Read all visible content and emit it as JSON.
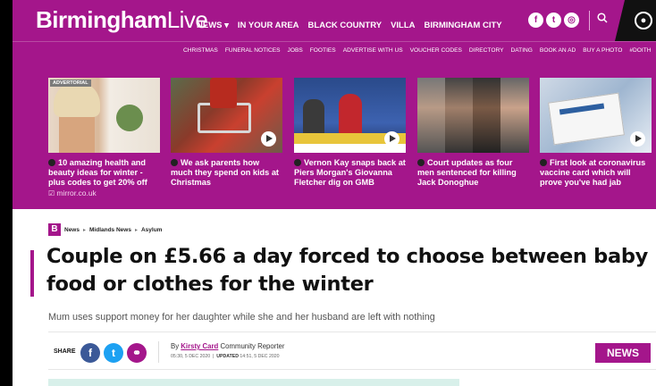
{
  "header": {
    "logo_bold": "Birmingham",
    "logo_light": "Live",
    "nav": [
      "NEWS ▾",
      "IN YOUR AREA",
      "BLACK COUNTRY",
      "VILLA",
      "BIRMINGHAM CITY"
    ],
    "social_icons": [
      "facebook-icon",
      "twitter-icon",
      "instagram-icon"
    ],
    "search_icon": "search-icon",
    "account_icon": "account-icon"
  },
  "subnav": [
    "CHRISTMAS",
    "FUNERAL NOTICES",
    "JOBS",
    "FOOTIES",
    "ADVERTISE WITH US",
    "VOUCHER CODES",
    "DIRECTORY",
    "DATING",
    "BOOK AN AD",
    "BUY A PHOTO",
    "#DOITH"
  ],
  "promo": [
    {
      "tag": "ADVERTORIAL",
      "text": "10 amazing health and beauty ideas for winter - plus codes to get 20% off",
      "source": "mirror.co.uk",
      "play": false
    },
    {
      "text": "We ask parents how much they spend on kids at Christmas",
      "play": true
    },
    {
      "text": "Vernon Kay snaps back at Piers Morgan's Giovanna Fletcher dig on GMB",
      "play": true
    },
    {
      "text": "Court updates as four men sentenced for killing Jack Donoghue",
      "play": false
    },
    {
      "text": "First look at coronavirus vaccine card which will prove you've had jab",
      "play": true
    }
  ],
  "breadcrumb": {
    "logo": "B",
    "items": [
      "News",
      "Midlands News",
      "Asylum"
    ]
  },
  "article": {
    "headline": "Couple on £5.66 a day forced to choose between baby food or clothes for the winter",
    "standfirst": "Mum uses support money for her daughter while she and her husband are left with nothing",
    "share_label": "SHARE",
    "by": "By",
    "author": "Kirsty Card",
    "role": "Community Reporter",
    "published": "05:30, 5 DEC 2020",
    "updated_label": "UPDATED",
    "updated": "14:51, 5 DEC 2020",
    "category": "NEWS"
  },
  "colors": {
    "brand": "#a4168b",
    "facebook": "#3b5998",
    "twitter": "#1da1f2"
  }
}
